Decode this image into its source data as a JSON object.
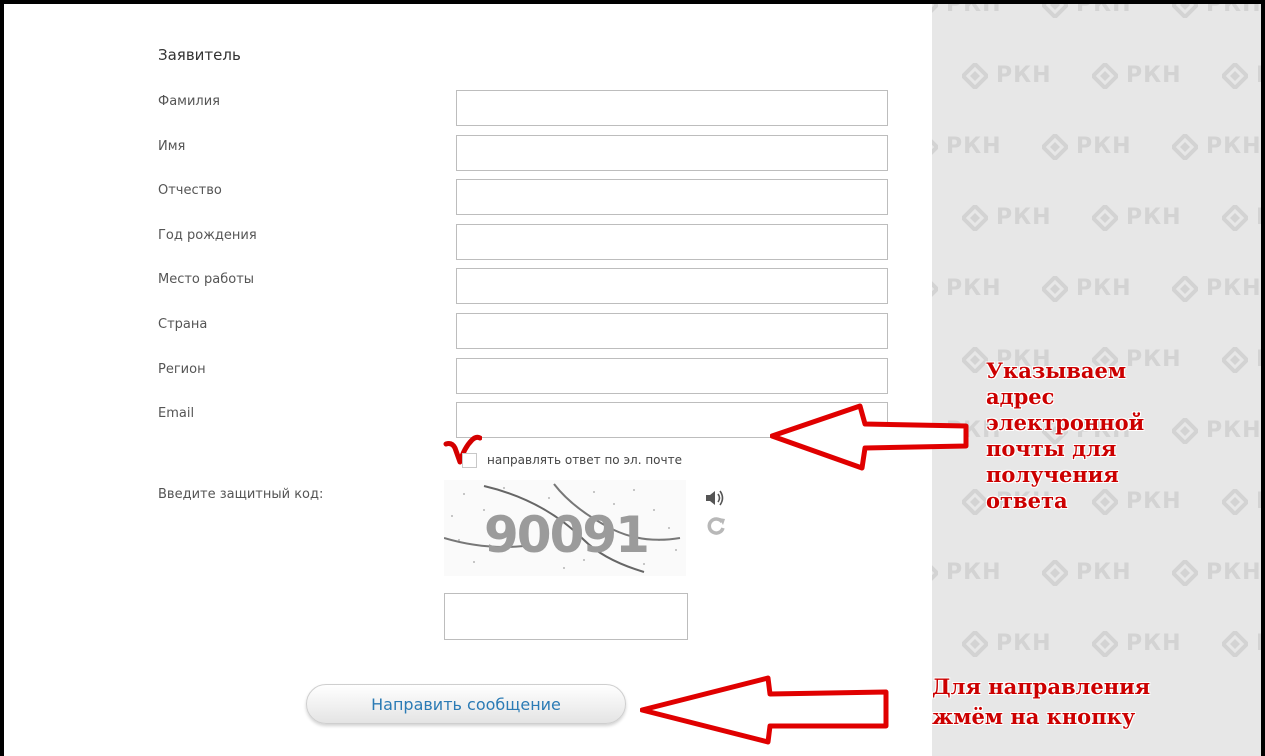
{
  "form": {
    "section_title": "Заявитель",
    "fields": [
      {
        "label": "Фамилия",
        "value": ""
      },
      {
        "label": "Имя",
        "value": ""
      },
      {
        "label": "Отчество",
        "value": ""
      },
      {
        "label": "Год рождения",
        "value": ""
      },
      {
        "label": "Место работы",
        "value": ""
      },
      {
        "label": "Страна",
        "value": ""
      },
      {
        "label": "Регион",
        "value": ""
      },
      {
        "label": "Email",
        "value": ""
      }
    ],
    "checkbox_label": "направлять ответ по эл. почте",
    "checkbox_checked": false,
    "captcha_label": "Введите защитный код:",
    "captcha_text": "90091",
    "captcha_value": "",
    "submit_label": "Направить сообщение"
  },
  "watermark": {
    "text": "РКН"
  },
  "annotations": {
    "email_note": [
      "Указываем",
      "адрес",
      "электронной",
      "почты для",
      "получения",
      "ответа"
    ],
    "submit_note": [
      "Для направления",
      "жмём на кнопку"
    ],
    "color": "#cc0000"
  },
  "icons": {
    "audio": "speaker-icon",
    "refresh": "refresh-icon"
  }
}
